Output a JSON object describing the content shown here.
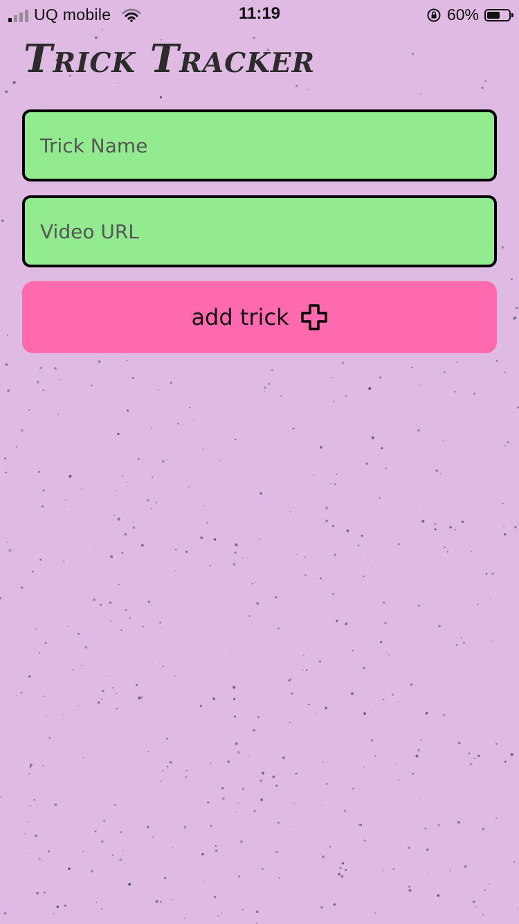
{
  "status_bar": {
    "carrier": "UQ mobile",
    "time": "11:19",
    "battery_percent": "60%",
    "battery_level": 0.6
  },
  "app": {
    "title": "Trick Tracker",
    "background_color": "#dfbbe3"
  },
  "form": {
    "trick_name": {
      "placeholder": "Trick Name",
      "value": ""
    },
    "video_url": {
      "placeholder": "Video URL",
      "value": ""
    },
    "field_color": "#92eb8e",
    "add_button": {
      "label": "add trick",
      "icon": "plus-icon",
      "color": "#ff69ad"
    }
  }
}
